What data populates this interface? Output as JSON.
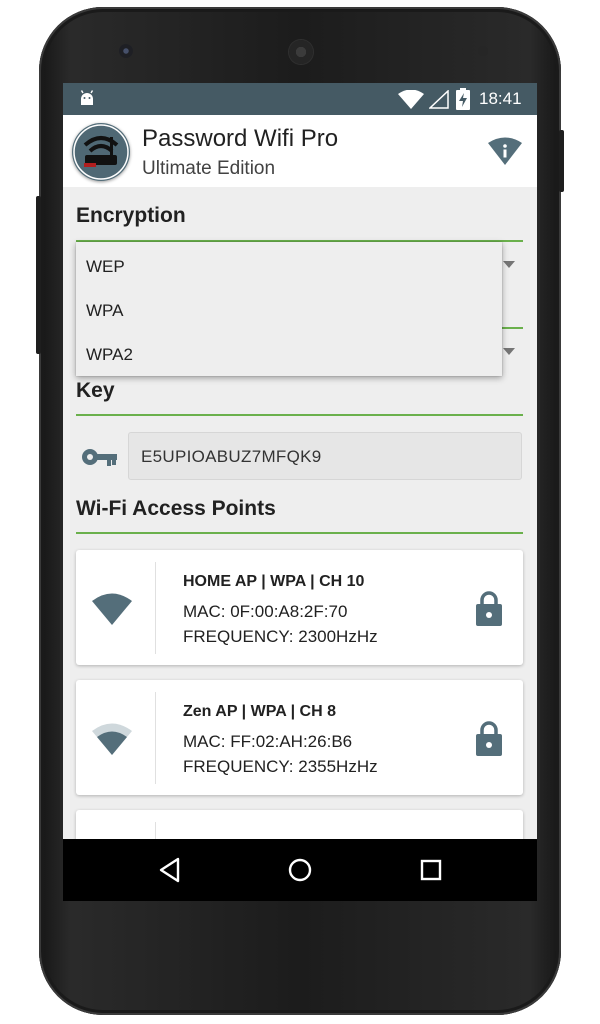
{
  "status_bar": {
    "time": "18:41"
  },
  "app_bar": {
    "title": "Password Wifi Pro",
    "subtitle": "Ultimate Edition"
  },
  "encryption": {
    "title": "Encryption",
    "options": [
      "WEP",
      "WPA",
      "WPA2"
    ]
  },
  "key": {
    "title": "Key",
    "value": "E5UPIOABUZ7MFQK9"
  },
  "access_points": {
    "title": "Wi-Fi Access Points",
    "items": [
      {
        "name": "HOME AP | WPA | CH 10",
        "mac": "MAC: 0F:00:A8:2F:70",
        "frequency": "FREQUENCY: 2300HzHz",
        "signal": 1.0,
        "icon": "lock-icon"
      },
      {
        "name": "Zen AP | WPA | CH 8",
        "mac": "MAC: FF:02:AH:26:B6",
        "frequency": "FREQUENCY: 2355HzHz",
        "signal": 0.6,
        "icon": "lock-icon"
      }
    ]
  },
  "colors": {
    "status_bar": "#455a64",
    "accent_line": "#6ab04c",
    "icon": "#546e7a"
  }
}
